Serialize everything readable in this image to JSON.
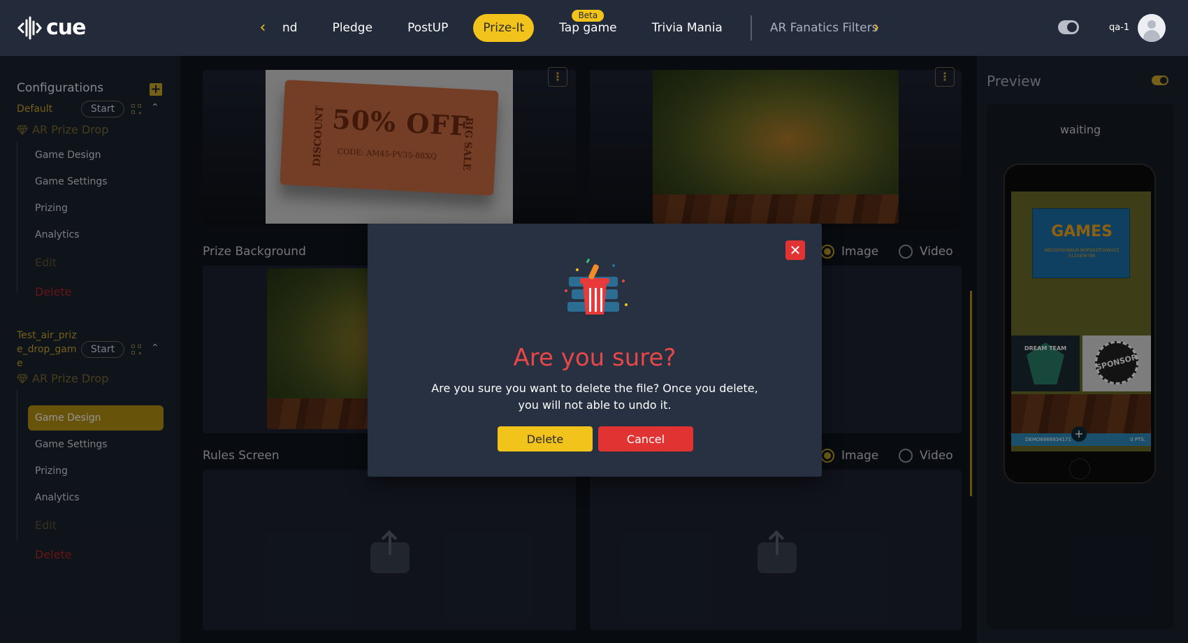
{
  "app": {
    "logo_text": "cue"
  },
  "nav": {
    "tabs": [
      {
        "label": "nd",
        "active": false
      },
      {
        "label": "Pledge",
        "active": false
      },
      {
        "label": "PostUP",
        "active": false
      },
      {
        "label": "Prize-It",
        "active": true
      },
      {
        "label": "Tap game",
        "active": false,
        "badge": "Beta"
      },
      {
        "label": "Trivia Mania",
        "active": false
      },
      {
        "label": "AR Fanatics Filters",
        "active": false,
        "muted": true
      }
    ],
    "prev_icon": "chevron-left-icon",
    "next_icon": "chevron-right-icon"
  },
  "user": {
    "name": "qa-1"
  },
  "sidebar": {
    "title": "Configurations",
    "add_icon": "plus-icon",
    "configs": [
      {
        "name": "Default",
        "start_label": "Start",
        "game_type": "AR Prize Drop",
        "items": [
          "Game Design",
          "Game Settings",
          "Prizing",
          "Analytics"
        ],
        "edit_label": "Edit",
        "delete_label": "Delete",
        "active_item": null
      },
      {
        "name": "Test_air_prize_drop_game",
        "name_lines": [
          "Test_air_priz",
          "e_drop_gam",
          "e"
        ],
        "start_label": "Start",
        "game_type": "AR Prize Drop",
        "items": [
          "Game Design",
          "Game Settings",
          "Prizing",
          "Analytics"
        ],
        "edit_label": "Edit",
        "delete_label": "Delete",
        "active_item": "Game Design"
      }
    ]
  },
  "main": {
    "sections": [
      {
        "label": "Prize Background",
        "options": [
          "Image",
          "Video"
        ],
        "selected": "Image"
      },
      {
        "label": "Rules Screen",
        "options": [
          "Image",
          "Video"
        ],
        "selected": "Image"
      }
    ],
    "ticket": {
      "headline": "50% OFF",
      "code": "CODE: AM45-PV35-88XQ",
      "left_text": "DISCOUNT",
      "right_text": "BIG SALE"
    }
  },
  "preview": {
    "title": "Preview",
    "status": "waiting",
    "games_title": "GAMES",
    "games_sub": "ABCDEFGHIJKLM NOPQRSTUVWXYZ 0123456789",
    "tile_a_text": "DREAM TEAM",
    "tile_b_text": "SPONSOR",
    "bar_left": "DEMO6668934171",
    "bar_right": "0 PTS."
  },
  "modal": {
    "title": "Are you sure?",
    "message": "Are you sure you want to delete the file? Once you delete, you will not able to undo it.",
    "delete_label": "Delete",
    "cancel_label": "Cancel",
    "close_icon": "close-icon"
  },
  "colors": {
    "accent": "#f2c31b",
    "danger": "#e23333",
    "title_red": "#e84747",
    "topbar": "#232a39",
    "sidebar": "#1b212d",
    "modal": "#273142"
  }
}
